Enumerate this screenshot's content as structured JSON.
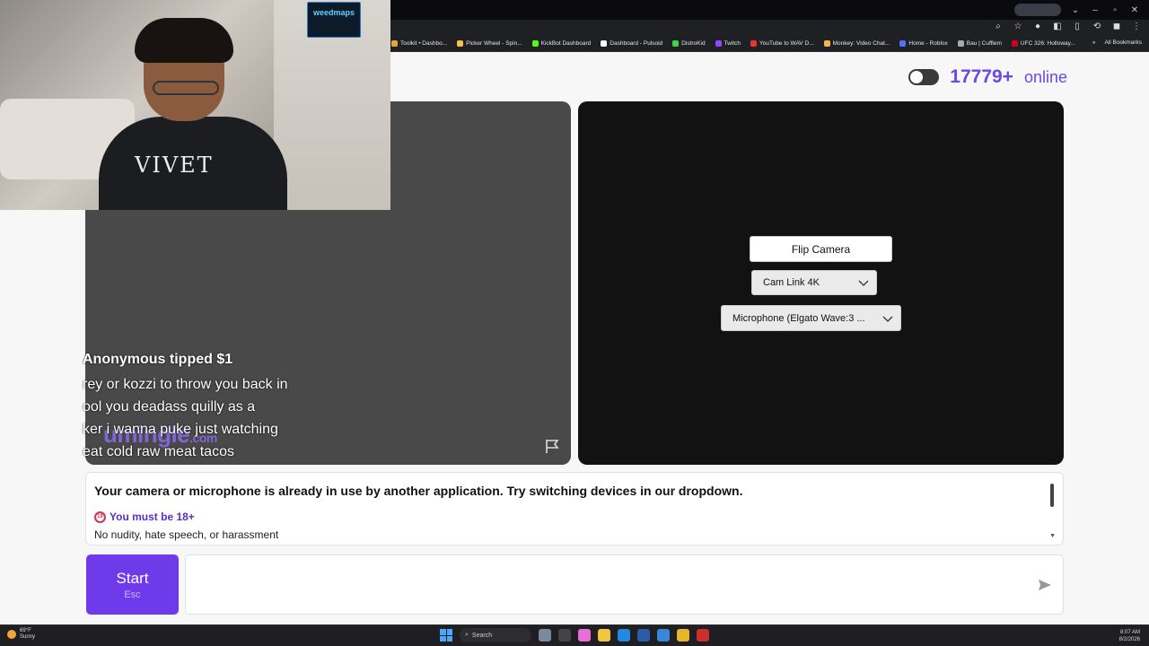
{
  "browser": {
    "tab_pill": "",
    "bookmarks": [
      {
        "label": "Toolkit • Dashbo...",
        "color": "#e2a72e"
      },
      {
        "label": "Picker Wheel - Spin...",
        "color": "#f5c242"
      },
      {
        "label": "KickBot Dashboard",
        "color": "#53fc18"
      },
      {
        "label": "Dashboard - Pulsoid",
        "color": "#ffffff"
      },
      {
        "label": "DistroKid",
        "color": "#3fd24b"
      },
      {
        "label": "Twitch",
        "color": "#9146ff"
      },
      {
        "label": "YouTube to WAV D...",
        "color": "#e33"
      },
      {
        "label": "Monkey: Video Chat...",
        "color": "#f3b84b"
      },
      {
        "label": "Home - Roblox",
        "color": "#5470ff"
      },
      {
        "label": "Bau | Cufflem",
        "color": "#aaaaaa"
      },
      {
        "label": "UFC 326: Holloway...",
        "color": "#d0021b"
      }
    ],
    "all_bookmarks": "All Bookmarks"
  },
  "webcam": {
    "sign_text": "weedmaps",
    "shirt_text": "VIVET"
  },
  "header": {
    "online_count": "17779+",
    "online_label": "online"
  },
  "partner_panel": {
    "logo": "umingle",
    "logo_tld": ".com"
  },
  "tip": {
    "title": "Anonymous tipped $1",
    "message_lines": [
      "rey or kozzi to throw you back in",
      "ool you deadass quilly as a",
      "ker i wanna puke just watching",
      "eat cold raw meat tacos"
    ]
  },
  "self_panel": {
    "flip_camera": "Flip Camera",
    "camera_select": "Cam Link 4K",
    "mic_select": "Microphone (Elgato Wave:3 ..."
  },
  "notice": {
    "error": "Your camera or microphone is already in use by another application. Try switching devices in our dropdown.",
    "age_badge": "18",
    "age_text": "You must be 18+",
    "rules": "No nudity, hate speech, or harassment"
  },
  "bottom": {
    "start_label": "Start",
    "start_key": "Esc"
  },
  "taskbar": {
    "temp": "69°F",
    "weather": "Sunny",
    "search": "Search",
    "time": "8:07 AM",
    "date": "8/2/2026"
  },
  "colors": {
    "accent": "#6f3bea",
    "online": "#6b48e0"
  }
}
